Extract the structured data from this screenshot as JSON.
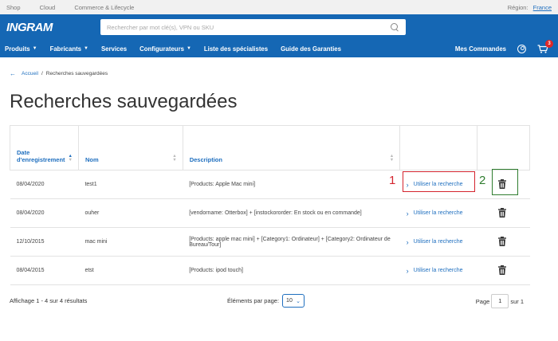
{
  "topbar": {
    "links": [
      "Shop",
      "Cloud",
      "Commerce & Lifecycle"
    ],
    "region_label": "Région:",
    "region_value": "France"
  },
  "header": {
    "logo": "INGRAM",
    "search_placeholder": "Rechercher par mot clé(s), VPN ou SKU"
  },
  "nav": {
    "items": [
      {
        "label": "Produits",
        "dropdown": true
      },
      {
        "label": "Fabricants",
        "dropdown": true
      },
      {
        "label": "Services",
        "dropdown": false
      },
      {
        "label": "Configurateurs",
        "dropdown": true
      },
      {
        "label": "Liste des spécialistes",
        "dropdown": false
      },
      {
        "label": "Guide des Garanties",
        "dropdown": false
      }
    ],
    "orders": "Mes Commandes",
    "cart_count": "3"
  },
  "breadcrumb": {
    "home": "Accueil",
    "separator": "/",
    "current": "Recherches sauvegardées"
  },
  "page_title": "Recherches sauvegardées",
  "table": {
    "headers": {
      "date": "Date d'enregistrement",
      "name": "Nom",
      "description": "Description"
    },
    "use_label": "Utiliser la recherche",
    "rows": [
      {
        "date": "08/04/2020",
        "name": "test1",
        "description": "[Products: Apple Mac mini]"
      },
      {
        "date": "08/04/2020",
        "name": "ouher",
        "description": "[vendorname: Otterbox] + [instockororder: En stock ou en commande]"
      },
      {
        "date": "12/10/2015",
        "name": "mac mini",
        "description": "[Products: apple mac mini] + [Category1: Ordinateur] + [Category2: Ordinateur de Bureau/Tour]"
      },
      {
        "date": "08/04/2015",
        "name": "etst",
        "description": "[Products: ipod touch]"
      }
    ]
  },
  "annotations": {
    "label1": "1",
    "label2": "2",
    "color1": "#d4242e",
    "color2": "#2f7d2f"
  },
  "footer": {
    "count_text": "Affichage 1 - 4 sur 4 résultats",
    "perpage_label": "Éléments par page:",
    "perpage_value": "10",
    "page_label": "Page",
    "page_value": "1",
    "page_total": "sur 1"
  },
  "colors": {
    "brand_blue": "#1567b4",
    "link_blue": "#1f6fbf"
  }
}
